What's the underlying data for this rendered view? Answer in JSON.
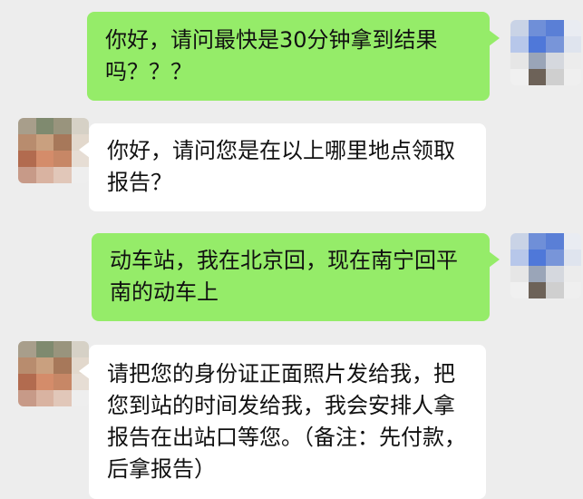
{
  "conversation": {
    "messages": [
      {
        "sender": "self",
        "text": "你好，请问最快是30分钟拿到结果吗？？？"
      },
      {
        "sender": "other",
        "text": "你好，请问您是在以上哪里地点领取报告？"
      },
      {
        "sender": "self",
        "text": "动车站，我在北京回，现在南宁回平南的动车上"
      },
      {
        "sender": "other",
        "text": "请把您的身份证正面照片发给我，把您到站的时间发给我，我会安排人拿报告在出站口等您。（备注：先付款，后拿报告）"
      }
    ]
  },
  "colors": {
    "background": "#ededed",
    "sent_bubble": "#95ec69",
    "received_bubble": "#ffffff"
  }
}
